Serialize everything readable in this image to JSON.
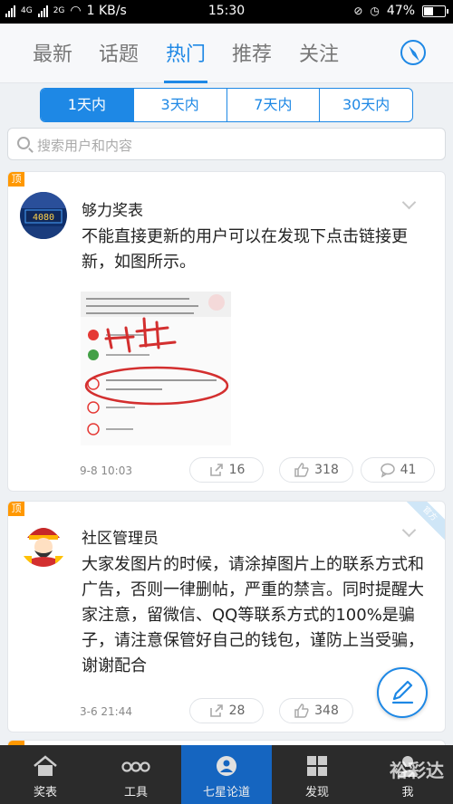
{
  "status_bar": {
    "network_label": "4G",
    "network_label_2": "2G",
    "speed": "1 KB/s",
    "time": "15:30",
    "battery": "47%",
    "battery_level": 0.47
  },
  "top_tabs": [
    {
      "label": "最新",
      "active": false
    },
    {
      "label": "话题",
      "active": false
    },
    {
      "label": "热门",
      "active": true
    },
    {
      "label": "推荐",
      "active": false
    },
    {
      "label": "关注",
      "active": false
    }
  ],
  "time_filter": [
    {
      "label": "1天内",
      "active": true
    },
    {
      "label": "3天内",
      "active": false
    },
    {
      "label": "7天内",
      "active": false
    },
    {
      "label": "30天内",
      "active": false
    }
  ],
  "search": {
    "placeholder": "搜索用户和内容"
  },
  "posts": [
    {
      "pin_label": "顶",
      "author": "够力奖表",
      "avatar_text": "4080",
      "text": "不能直接更新的用户可以在发现下点击链接更新，如图所示。",
      "date": "9-8 10:03",
      "shares": "16",
      "likes": "318",
      "comments": "41"
    },
    {
      "pin_label": "顶",
      "badge": "官方",
      "author": "社区管理员",
      "text": "大家发图片的时候，请涂掉图片上的联系方式和广告，否则一律删帖，严重的禁言。同时提醒大家注意，留微信、QQ等联系方式的100%是骗子，请注意保管好自己的钱包，谨防上当受骗，谢谢配合",
      "date": "3-6 21:44",
      "shares": "28",
      "likes": "348"
    }
  ],
  "bottom_nav": [
    {
      "label": "奖表",
      "icon": "home-icon",
      "active": false
    },
    {
      "label": "工具",
      "icon": "tools-icon",
      "active": false
    },
    {
      "label": "七星论道",
      "icon": "forum-icon",
      "active": true
    },
    {
      "label": "发现",
      "icon": "grid-icon",
      "active": false
    },
    {
      "label": "我",
      "icon": "user-icon",
      "active": false
    }
  ],
  "watermark": "裕彩达",
  "colors": {
    "accent": "#1e88e5",
    "pin": "#ff9800",
    "nav_bg": "#2b2b2b",
    "nav_active": "#1565c0"
  }
}
